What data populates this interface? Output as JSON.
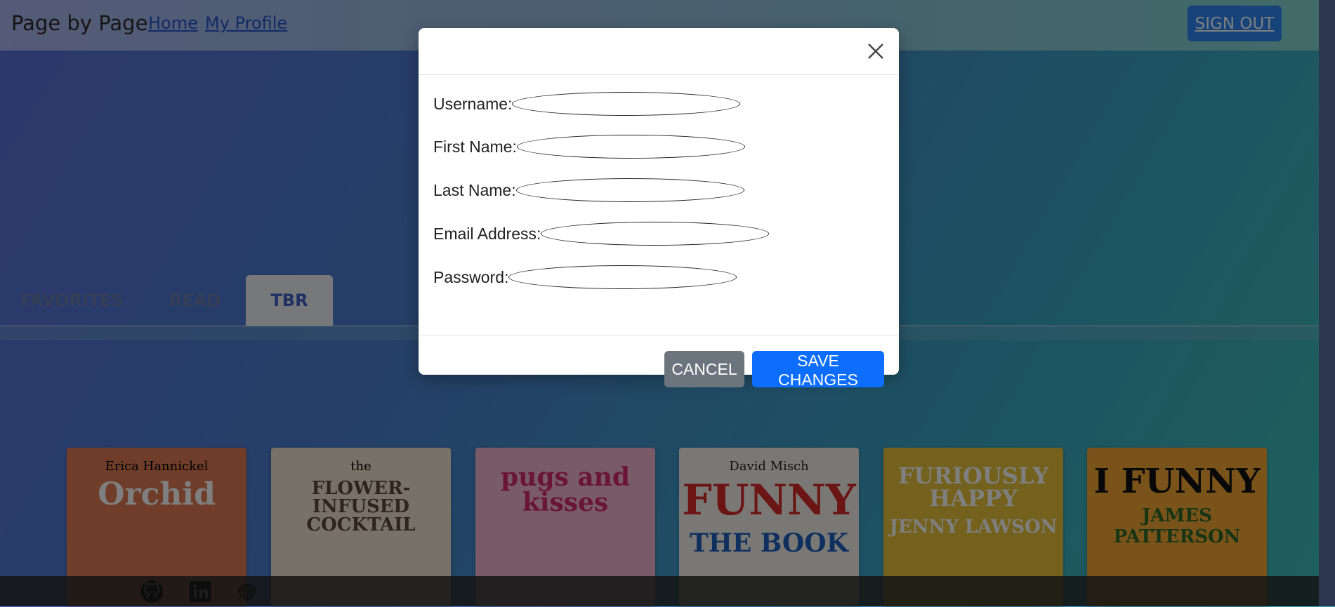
{
  "navbar": {
    "brand": "Page by Page",
    "links": [
      {
        "label": "Home"
      },
      {
        "label": "My Profile"
      }
    ],
    "signout_label": "SIGN OUT"
  },
  "tabs": [
    {
      "label": "FAVORITES"
    },
    {
      "label": "READ"
    },
    {
      "label": "TBR",
      "active": true
    }
  ],
  "books": [
    {
      "author": "Erica Hannickel",
      "title": "Orchid",
      "subtitle": "",
      "color": "#e07a55"
    },
    {
      "author": "the",
      "title": "FLOWER-INFUSED COCKTAIL",
      "subtitle": "",
      "color": "#efe2cf"
    },
    {
      "author": "",
      "title": "pugs and kisses",
      "subtitle": "",
      "color": "#f2b6cf"
    },
    {
      "author": "David Misch",
      "title": "FUNNY",
      "subtitle": "THE BOOK",
      "color": "#f4f1ea"
    },
    {
      "author": "",
      "title": "FURIOUSLY HAPPY",
      "subtitle": "JENNY LAWSON",
      "color": "#e8c23a"
    },
    {
      "author": "",
      "title": "I FUNNY",
      "subtitle": "JAMES PATTERSON",
      "color": "#f2a733"
    }
  ],
  "footer_icons": [
    "github-icon",
    "linkedin-icon",
    "fingerprint-icon"
  ],
  "modal": {
    "fields": [
      {
        "label": "Username:",
        "value": "",
        "placeholder": ""
      },
      {
        "label": "First Name:",
        "value": "",
        "placeholder": ""
      },
      {
        "label": "Last Name:",
        "value": "",
        "placeholder": ""
      },
      {
        "label": "Email Address:",
        "value": "",
        "placeholder": ""
      },
      {
        "label": "Password:",
        "value": "",
        "placeholder": ""
      }
    ],
    "cancel_label": "CANCEL",
    "save_label": "SAVE CHANGES"
  }
}
